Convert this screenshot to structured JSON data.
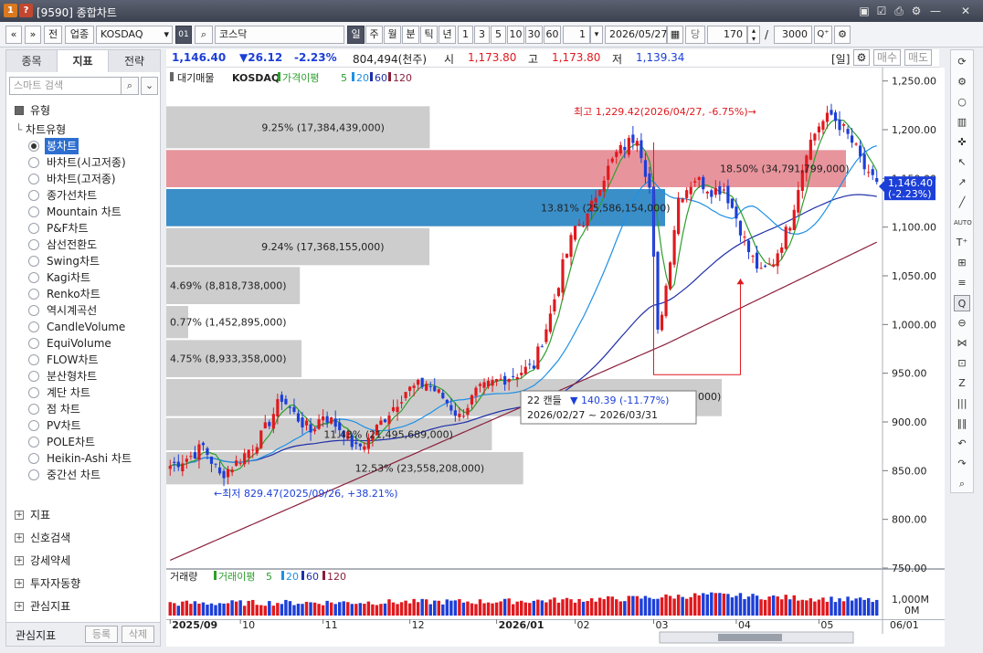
{
  "window": {
    "badge1": "1",
    "badge2": "?",
    "title": "[9590] 종합차트",
    "controls": [
      "▣",
      "☑",
      "⎙",
      "⚙",
      "—",
      "✕"
    ]
  },
  "toolbar": {
    "prev_prev": "«",
    "prev": "»",
    "jeon": "전",
    "sector_label": "업종",
    "market": "KOSDAQ",
    "market_caret": "▾",
    "dark_btn": "01",
    "search_glyph": "⌕",
    "index_name": "코스닥",
    "periods": [
      "일",
      "주",
      "월",
      "분",
      "틱",
      "년"
    ],
    "active_period": "일",
    "intervals": [
      "1",
      "3",
      "5",
      "10",
      "30",
      "60"
    ],
    "count_value": "1",
    "date_value": "2026/05/27",
    "dang": "당",
    "bars_value": "170",
    "slash": "/",
    "total_value": "3000",
    "zoom_glyph": "Q⁺",
    "settings_glyph": "⚙"
  },
  "leftpanel": {
    "tabs": [
      "종목",
      "지표",
      "전략"
    ],
    "active_tab": "지표",
    "search_placeholder": "스마트 검색",
    "search_btn": "⌕",
    "collapse_btn": "⌄",
    "group_label": "유형",
    "tree_label": "차트유형",
    "chart_types": [
      "봉차트",
      "바차트(시고저종)",
      "바차트(고저종)",
      "종가선차트",
      "Mountain 차트",
      "P&F차트",
      "삼선전환도",
      "Swing차트",
      "Kagi차트",
      "Renko차트",
      "역시계곡선",
      "CandleVolume",
      "EquiVolume",
      "FLOW차트",
      "분산형차트",
      "계단 차트",
      "점 차트",
      "PV차트",
      "POLE차트",
      "Heikin-Ashi 차트",
      "중간선 차트"
    ],
    "selected_chart_type": "봉차트",
    "sections": [
      "지표",
      "신호검색",
      "강세약세",
      "투자자동향",
      "관심지표"
    ],
    "bottom_label": "관심지표",
    "bottom_buttons": [
      "등록",
      "삭제"
    ]
  },
  "infobar": {
    "price": "1,146.40",
    "change": "▼26.12",
    "change_pct": "-2.23%",
    "volume": "804,494(천주)",
    "open_label": "시",
    "open": "1,173.80",
    "high_label": "고",
    "high": "1,173.80",
    "low_label": "저",
    "low": "1,139.34",
    "period_badge": "[일]",
    "buy_btn": "매수",
    "sell_btn": "매도"
  },
  "chart_labels": {
    "price_legend": "대기매물",
    "legend_index": "KOSDAQ",
    "legend_ma_label": "가격이평",
    "ma_periods": [
      "5",
      "20",
      "60",
      "120"
    ],
    "volume_legend": "거래량",
    "volume_ma_label": "거래이평",
    "high_annotation": "최고 1,229.42(2026/04/27, -6.75%)→",
    "low_annotation": "←최저 829.47(2025/09/26, +38.21%)",
    "current_price_label": "1,146.40",
    "current_change_label": "(-2.23%)",
    "tooltip_line1": "22 캔들",
    "tooltip_line2": "▼ 140.39 (-11.77%)",
    "tooltip_line3": "2026/02/27 ~ 2026/03/31",
    "tooltip_hidden_tail": "000)",
    "vol_axis_top": "1,000M",
    "vol_axis_zero": "0M",
    "date_axis_end": "06/01"
  },
  "colors": {
    "up": "#e0191e",
    "down": "#1c3fd8",
    "ma5": "#2e9e2e",
    "ma20": "#1e90e6",
    "ma60": "#1f2fa8",
    "ma120": "#8a1f3a",
    "zone_pink": "#e8949c",
    "zone_blue": "#3b8fc9",
    "zone_gray": "#cdcdcd"
  },
  "chart_data": {
    "type": "candlestick",
    "ylim": [
      750,
      1260
    ],
    "y_ticks": [
      750,
      800,
      850,
      900,
      950,
      1000,
      1050,
      1100,
      1150,
      1200,
      1250
    ],
    "x_ticks": [
      "2025/09",
      "10",
      "11",
      "12",
      "2026/01",
      "02",
      "03",
      "04",
      "05"
    ],
    "x_tick_bars": [
      0,
      17,
      37,
      58,
      79,
      98,
      117,
      137,
      157
    ],
    "bar_count": 172,
    "high_point": {
      "value": 1229.42,
      "date": "2026/04/27",
      "pct": -6.75
    },
    "low_point": {
      "value": 829.47,
      "date": "2025/09/26",
      "pct": 38.21
    },
    "last_close": 1146.4,
    "price_path": [
      [
        0,
        855
      ],
      [
        5,
        865
      ],
      [
        8,
        875
      ],
      [
        12,
        845
      ],
      [
        16,
        858
      ],
      [
        22,
        885
      ],
      [
        27,
        925
      ],
      [
        30,
        908
      ],
      [
        34,
        890
      ],
      [
        37,
        908
      ],
      [
        42,
        890
      ],
      [
        45,
        872
      ],
      [
        48,
        882
      ],
      [
        52,
        905
      ],
      [
        57,
        932
      ],
      [
        62,
        940
      ],
      [
        66,
        925
      ],
      [
        70,
        905
      ],
      [
        74,
        930
      ],
      [
        79,
        942
      ],
      [
        83,
        948
      ],
      [
        88,
        958
      ],
      [
        92,
        1010
      ],
      [
        95,
        1060
      ],
      [
        98,
        1100
      ],
      [
        101,
        1110
      ],
      [
        104,
        1145
      ],
      [
        108,
        1175
      ],
      [
        113,
        1195
      ],
      [
        116,
        1140
      ],
      [
        118,
        990
      ],
      [
        120,
        1040
      ],
      [
        123,
        1130
      ],
      [
        127,
        1150
      ],
      [
        131,
        1138
      ],
      [
        134,
        1140
      ],
      [
        137,
        1110
      ],
      [
        140,
        1075
      ],
      [
        143,
        1052
      ],
      [
        146,
        1065
      ],
      [
        150,
        1105
      ],
      [
        154,
        1180
      ],
      [
        157,
        1205
      ],
      [
        160,
        1215
      ],
      [
        163,
        1200
      ],
      [
        166,
        1180
      ],
      [
        169,
        1150
      ],
      [
        171,
        1146
      ]
    ],
    "volume_ylim": [
      0,
      1400
    ],
    "volume_path": [
      [
        0,
        520
      ],
      [
        40,
        560
      ],
      [
        80,
        600
      ],
      [
        110,
        720
      ],
      [
        130,
        880
      ],
      [
        150,
        760
      ],
      [
        171,
        640
      ]
    ],
    "supply_zones": [
      {
        "label": "12.53% (23,558,208,000)",
        "low": 835,
        "high": 870,
        "pct": 12.53
      },
      {
        "label": "11.43% (21,495,689,000)",
        "low": 870,
        "high": 905,
        "pct": 11.43
      },
      {
        "label": "",
        "low": 905,
        "high": 945,
        "pct": 19.5
      },
      {
        "label": "4.75% (8,933,358,000)",
        "low": 945,
        "high": 985,
        "pct": 4.75
      },
      {
        "label": "0.77% (1,452,895,000)",
        "low": 985,
        "high": 1020,
        "pct": 0.77
      },
      {
        "label": "4.69% (8,818,738,000)",
        "low": 1020,
        "high": 1060,
        "pct": 4.69
      },
      {
        "label": "9.24% (17,368,155,000)",
        "low": 1060,
        "high": 1100,
        "pct": 9.24
      },
      {
        "label": "13.81% (25,586,154,000)",
        "low": 1100,
        "high": 1140,
        "pct": 13.81
      },
      {
        "label": "18.50% (34,791,799,000)",
        "low": 1140,
        "high": 1180,
        "pct": 18.5
      },
      {
        "label": "9.25% (17,384,439,000)",
        "low": 1180,
        "high": 1225,
        "pct": 9.25
      }
    ],
    "highlight_zones": [
      {
        "low": 1140,
        "high": 1180,
        "kind": "current"
      },
      {
        "low": 1100,
        "high": 1140,
        "kind": "support"
      }
    ],
    "measure": {
      "start_bar": 117,
      "end_bar": 138,
      "start_value": 1187,
      "end_value": 1047
    }
  }
}
